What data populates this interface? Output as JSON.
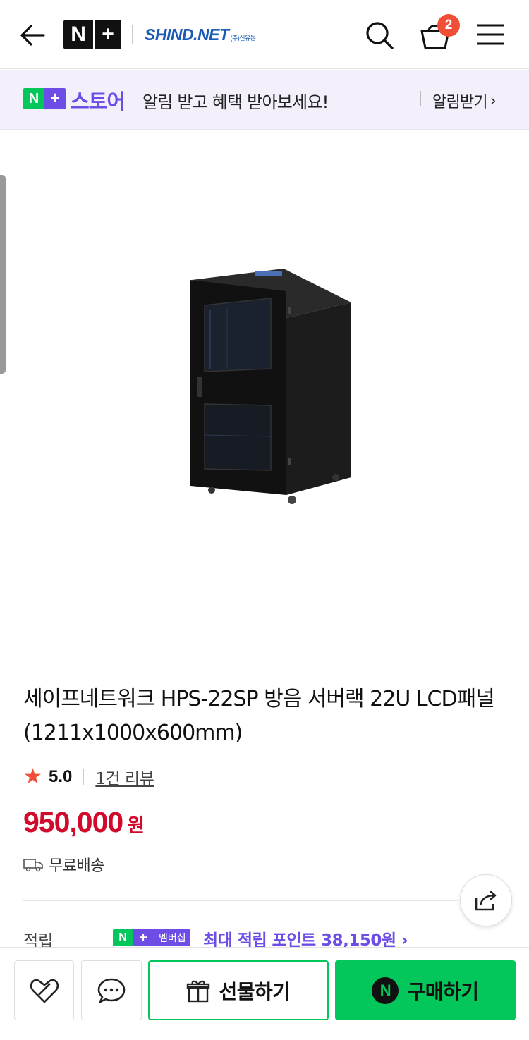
{
  "header": {
    "np_logo_n": "N",
    "np_logo_plus": "+",
    "shop_logo": "SHIND.NET",
    "shop_logo_sub": "(주)신유통",
    "cart_count": "2",
    "icons": [
      "back-arrow-icon",
      "search-icon",
      "shopping-bag-icon",
      "hamburger-menu-icon"
    ]
  },
  "store_banner": {
    "badge_n": "N",
    "badge_plus": "+",
    "store_label": "스토어",
    "message": "알림 받고 혜택 받아보세요!",
    "notify_label": "알림받기",
    "chevron": "›"
  },
  "product": {
    "title": "세이프네트워크 HPS-22SP 방음 서버랙 22U LCD패널 (1211x1000x600mm)",
    "rating_star": "★",
    "rating": "5.0",
    "review_link": "1건 리뷰",
    "price": "950,000",
    "price_unit": "원",
    "shipping": "무료배송",
    "points_label": "적립",
    "membership_n": "N",
    "membership_plus": "+",
    "membership_label": "멤버십",
    "points_text": "최대 적립 포인트 38,150원 ›"
  },
  "actions": {
    "gift_label": "선물하기",
    "buy_label": "구매하기",
    "npay_letter": "N"
  },
  "colors": {
    "naver_green": "#03c75a",
    "naver_purple": "#6d4de6",
    "price_red": "#d10a2c",
    "badge_red": "#f04e37"
  }
}
